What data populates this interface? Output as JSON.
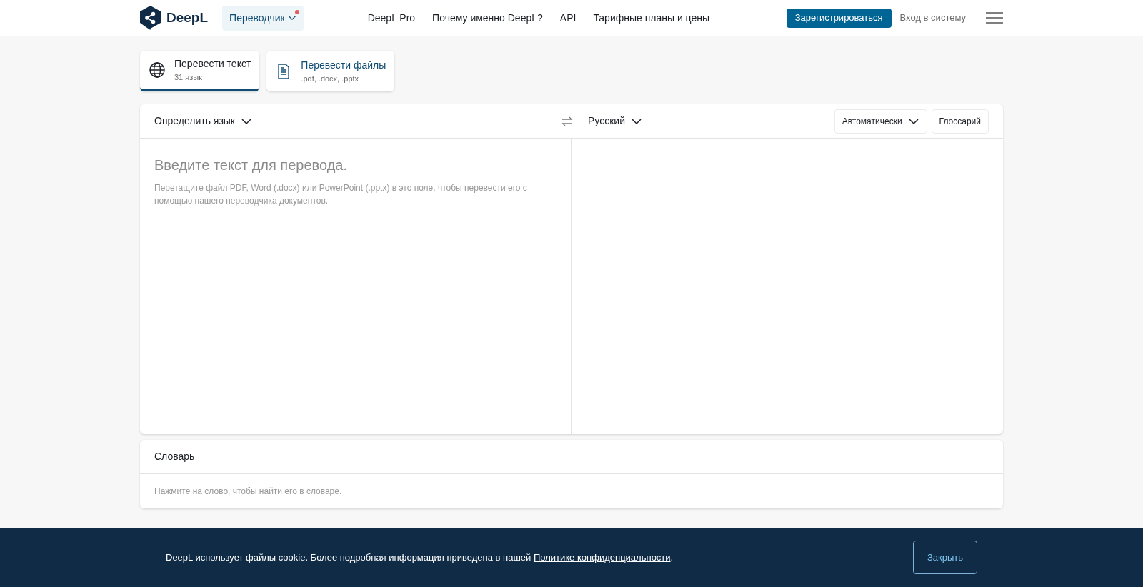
{
  "header": {
    "logo_text": "DeepL",
    "product_menu": {
      "label": "Переводчик",
      "notification": true
    },
    "nav": [
      "DeepL Pro",
      "Почему именно DeepL?",
      "API",
      "Тарифные планы и цены"
    ],
    "signup_button": "Зарегистрироваться",
    "login_link": "Вход в систему"
  },
  "mode_tabs": [
    {
      "kind": "text",
      "title": "Перевести текст",
      "subtitle": "31 язык",
      "selected": true
    },
    {
      "kind": "files",
      "title": "Перевести файлы",
      "subtitle": ".pdf, .docx, .pptx",
      "selected": false
    }
  ],
  "translator": {
    "source_language": "Определить язык",
    "target_language": "Русский",
    "formality": "Автоматически",
    "glossary_button": "Глоссарий",
    "input_placeholder": "Введите текст для перевода.",
    "input_hint": "Перетащите файл PDF, Word (.docx) или PowerPoint (.pptx) в это поле, чтобы перевести его с помощью нашего переводчика документов."
  },
  "dictionary": {
    "title": "Словарь",
    "hint": "Нажмите на слово, чтобы найти его в словаре."
  },
  "cookie_banner": {
    "text_before": "DeepL использует файлы cookie. Более подробная информация приведена в нашей ",
    "link": "Политике конфиденциальности",
    "text_after": ".",
    "close_button": "Закрыть"
  }
}
